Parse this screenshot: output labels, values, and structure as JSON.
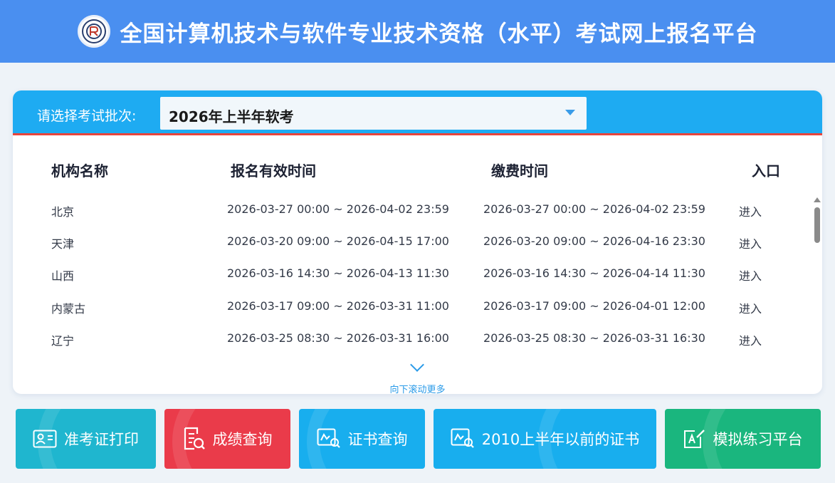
{
  "header": {
    "title": "全国计算机技术与软件专业技术资格（水平）考试网上报名平台",
    "logo_icon": "seal-logo-icon"
  },
  "selector": {
    "label": "请选择考试批次:",
    "value": "2026年上半年软考"
  },
  "table": {
    "columns": [
      "机构名称",
      "报名有效时间",
      "缴费时间",
      "入口"
    ],
    "rows": [
      {
        "org": "北京",
        "reg": "2026-03-27 00:00 ~ 2026-04-02 23:59",
        "pay": "2026-03-27 00:00 ~ 2026-04-02 23:59",
        "entry": "进入"
      },
      {
        "org": "天津",
        "reg": "2026-03-20 09:00 ~ 2026-04-15 17:00",
        "pay": "2026-03-20 09:00 ~ 2026-04-16 23:30",
        "entry": "进入"
      },
      {
        "org": "山西",
        "reg": "2026-03-16 14:30 ~ 2026-04-13 11:30",
        "pay": "2026-03-16 14:30 ~ 2026-04-14 11:30",
        "entry": "进入"
      },
      {
        "org": "内蒙古",
        "reg": "2026-03-17 09:00 ~ 2026-03-31 11:00",
        "pay": "2026-03-17 09:00 ~ 2026-04-01 12:00",
        "entry": "进入"
      },
      {
        "org": "辽宁",
        "reg": "2026-03-25 08:30 ~ 2026-03-31 16:00",
        "pay": "2026-03-25 08:30 ~ 2026-03-31 16:30",
        "entry": "进入"
      }
    ]
  },
  "scroll_hint": "向下滚动更多",
  "buttons": [
    {
      "label": "准考证打印",
      "color": "#1fb6cf"
    },
    {
      "label": "成绩查询",
      "color": "#ea3b4a"
    },
    {
      "label": "证书查询",
      "color": "#18aeee"
    },
    {
      "label": "2010上半年以前的证书",
      "color": "#18aeee"
    },
    {
      "label": "模拟练习平台",
      "color": "#1ab67e"
    }
  ],
  "colors": {
    "header_bg": "#4a8ff0",
    "select_bar_bg": "#1eabf2",
    "accent_red": "#e8453c",
    "link_blue": "#2b9be8"
  }
}
